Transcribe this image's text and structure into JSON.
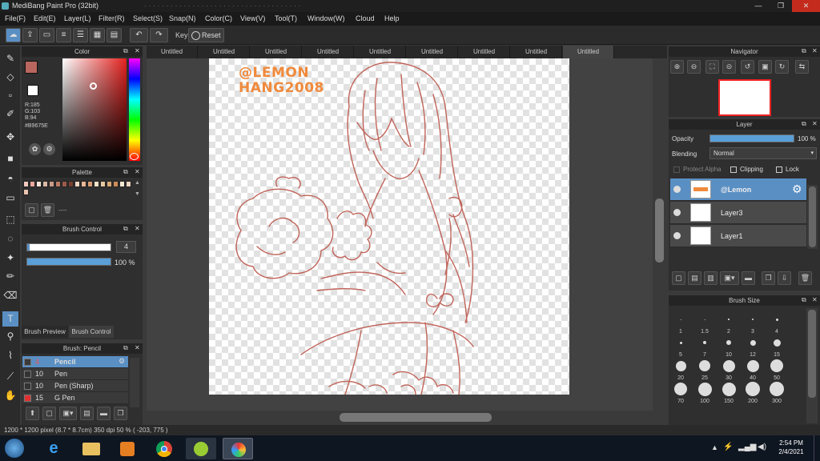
{
  "title": "MediBang Paint Pro (32bit)",
  "title_ghost": "· · · · · · · · · · · · · · · · · · · · · · · · · · · · · · · · · · · ·",
  "window_controls": {
    "minimize": "—",
    "maximize": "❐",
    "close": "✕"
  },
  "menu": [
    "File(F)",
    "Edit(E)",
    "Layer(L)",
    "Filter(R)",
    "Select(S)",
    "Snap(N)",
    "Color(C)",
    "View(V)",
    "Tool(T)",
    "Window(W)",
    "Cloud",
    "Help"
  ],
  "toolbar": {
    "key_label": "Key",
    "reset_label": "Reset"
  },
  "color_panel": {
    "title": "Color",
    "r": "R:185",
    "g": "G:103",
    "b": "B:94",
    "hex": "#B9675E",
    "primary_color": "#B9675E"
  },
  "palette_panel": {
    "title": "Palette",
    "dash": "----",
    "swatches": [
      "#f2c9c1",
      "#e8a89b",
      "#f7e3d8",
      "#d7b8a8",
      "#c99c8a",
      "#b97a64",
      "#9c5b4a",
      "#7a3e30",
      "#f3d6c4",
      "#e9b894",
      "#d79c76",
      "#f2e0c8",
      "#e6c8a0",
      "#d9a978",
      "#c98c5a",
      "#f5e8d5",
      "#ebd4bd",
      "#e8c4b0"
    ]
  },
  "brush_control": {
    "title": "Brush Control",
    "size_value": "4",
    "opacity_value": "100 %",
    "tab_preview": "Brush Preview",
    "tab_control": "Brush Control"
  },
  "brush_list": {
    "title": "Brush: Pencil",
    "items": [
      {
        "num": "4",
        "name": "Pencil",
        "color": "#3a3a3a"
      },
      {
        "num": "10",
        "name": "Pen",
        "color": "#333333"
      },
      {
        "num": "10",
        "name": "Pen (Sharp)",
        "color": "#333333"
      },
      {
        "num": "15",
        "name": "G Pen",
        "color": "#e03030"
      }
    ]
  },
  "tabs": [
    "Untitled",
    "Untitled",
    "Untitled",
    "Untitled",
    "Untitled",
    "Untitled",
    "Untitled",
    "Untitled",
    "Untitled"
  ],
  "watermark": {
    "line1": "@LEMON",
    "line2": "HANG2008"
  },
  "navigator": {
    "title": "Navigator"
  },
  "layer_panel": {
    "title": "Layer",
    "opacity_label": "Opacity",
    "opacity_value": "100 %",
    "blending_label": "Blending",
    "blending_value": "Normal",
    "protect_alpha": "Protect Alpha",
    "clipping": "Clipping",
    "lock": "Lock",
    "layers": [
      {
        "name": "@Lemon"
      },
      {
        "name": "Layer3"
      },
      {
        "name": "Layer1"
      }
    ]
  },
  "brush_size": {
    "title": "Brush Size",
    "sizes": [
      "1",
      "1.5",
      "2",
      "3",
      "4",
      "5",
      "7",
      "10",
      "12",
      "15",
      "20",
      "25",
      "30",
      "40",
      "50",
      "70",
      "100",
      "150",
      "200",
      "300"
    ]
  },
  "status": {
    "text": "1200 * 1200 pixel   (8.7 * 8.7cm)   350 dpi   50 %   ( -203, 775 )"
  },
  "taskbar": {
    "time": "2:54 PM",
    "date": "2/4/2021"
  },
  "colors": {
    "accent": "#5a8fc4",
    "line": "#c0645a"
  }
}
